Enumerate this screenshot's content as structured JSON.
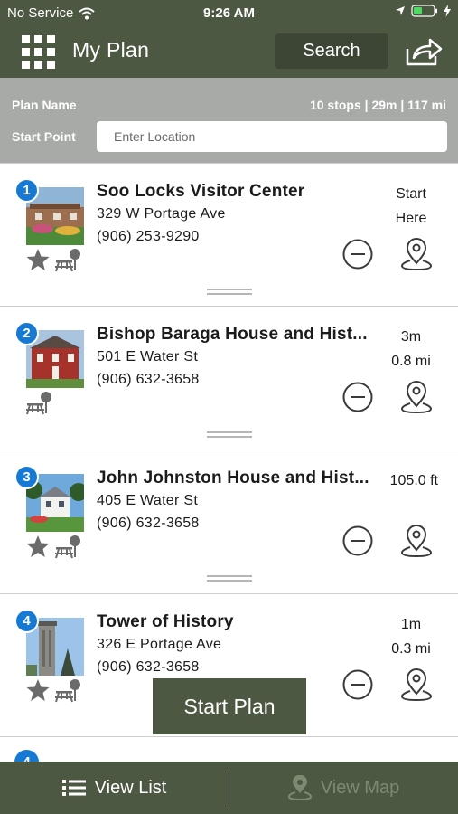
{
  "status_bar": {
    "carrier": "No Service",
    "time": "9:26 AM"
  },
  "header": {
    "title": "My Plan",
    "search_label": "Search"
  },
  "plan": {
    "name_label": "Plan Name",
    "stats": "10 stops | 29m | 117 mi",
    "start_label": "Start Point",
    "start_placeholder": "Enter Location"
  },
  "stops": [
    {
      "number": "1",
      "name": "Soo Locks Visitor Center",
      "address": "329 W Portage Ave",
      "phone": "(906) 253-9290",
      "time": "Start",
      "distance": "Here",
      "amenities": [
        "star-icon",
        "picnic-icon"
      ]
    },
    {
      "number": "2",
      "name": "Bishop Baraga House and Hist...",
      "address": "501 E Water St",
      "phone": "(906) 632-3658",
      "time": "3m",
      "distance": "0.8 mi",
      "amenities": [
        "picnic-icon"
      ]
    },
    {
      "number": "3",
      "name": "John Johnston House and Hist...",
      "address": "405 E Water St",
      "phone": "(906) 632-3658",
      "time": "",
      "distance": "105.0 ft",
      "amenities": [
        "star-icon",
        "picnic-icon"
      ]
    },
    {
      "number": "4",
      "name": "Tower of History",
      "address": "326 E Portage Ave",
      "phone": "(906) 632-3658",
      "time": "1m",
      "distance": "0.3 mi",
      "amenities": [
        "star-icon",
        "picnic-icon"
      ]
    }
  ],
  "partial_stop": {
    "number": "4"
  },
  "start_plan_label": "Start Plan",
  "tabs": {
    "list_label": "View List",
    "map_label": "View Map"
  },
  "colors": {
    "header": "#4d5843",
    "plan_bar": "#a7aaa6",
    "badge": "#1679d4",
    "tab_disabled": "#7d8a72"
  }
}
